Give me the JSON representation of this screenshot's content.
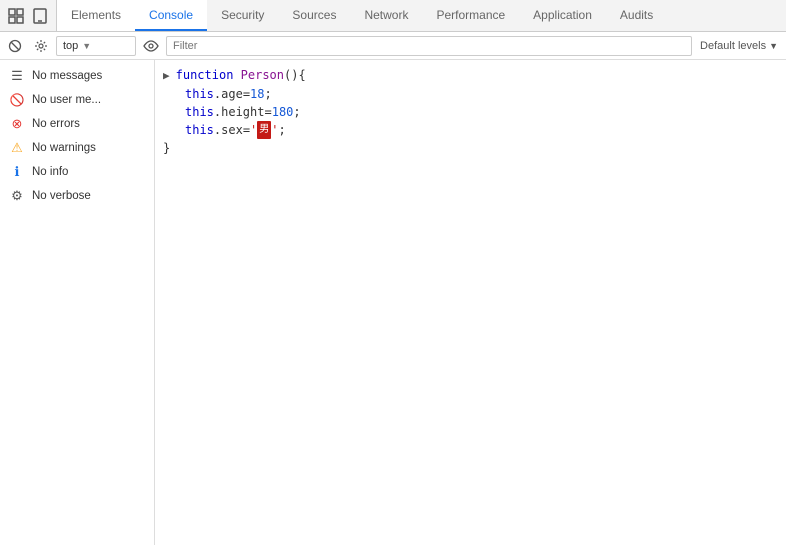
{
  "tabs": [
    {
      "id": "elements",
      "label": "Elements",
      "active": false
    },
    {
      "id": "console",
      "label": "Console",
      "active": true
    },
    {
      "id": "security",
      "label": "Security",
      "active": false
    },
    {
      "id": "sources",
      "label": "Sources",
      "active": false
    },
    {
      "id": "network",
      "label": "Network",
      "active": false
    },
    {
      "id": "performance",
      "label": "Performance",
      "active": false
    },
    {
      "id": "application",
      "label": "Application",
      "active": false
    },
    {
      "id": "audits",
      "label": "Audits",
      "active": false
    }
  ],
  "toolbar": {
    "context": "top",
    "filter_placeholder": "Filter",
    "default_levels_label": "Default levels"
  },
  "sidebar": {
    "items": [
      {
        "id": "messages",
        "icon": "list",
        "label": "No messages"
      },
      {
        "id": "user",
        "icon": "user",
        "label": "No user me..."
      },
      {
        "id": "errors",
        "icon": "error",
        "label": "No errors"
      },
      {
        "id": "warnings",
        "icon": "warning",
        "label": "No warnings"
      },
      {
        "id": "info",
        "icon": "info",
        "label": "No info"
      },
      {
        "id": "verbose",
        "icon": "verbose",
        "label": "No verbose"
      }
    ]
  },
  "console_code": {
    "line1_arrow": "▶",
    "line1_fn_kw": "function",
    "line1_fn_name": "Person",
    "line1_paren": "()",
    "line1_brace": "{",
    "line2_this": "this",
    "line2_prop": ".age",
    "line2_eq": " = ",
    "line2_val": "18",
    "line2_semi": ";",
    "line3_this": "this",
    "line3_prop": ".height",
    "line3_eq": " = ",
    "line3_val": "180",
    "line3_semi": ";",
    "line4_this": "this",
    "line4_prop": ".sex",
    "line4_eq": " = '",
    "line4_char": "男",
    "line4_close": "';",
    "line5_brace": "}"
  }
}
